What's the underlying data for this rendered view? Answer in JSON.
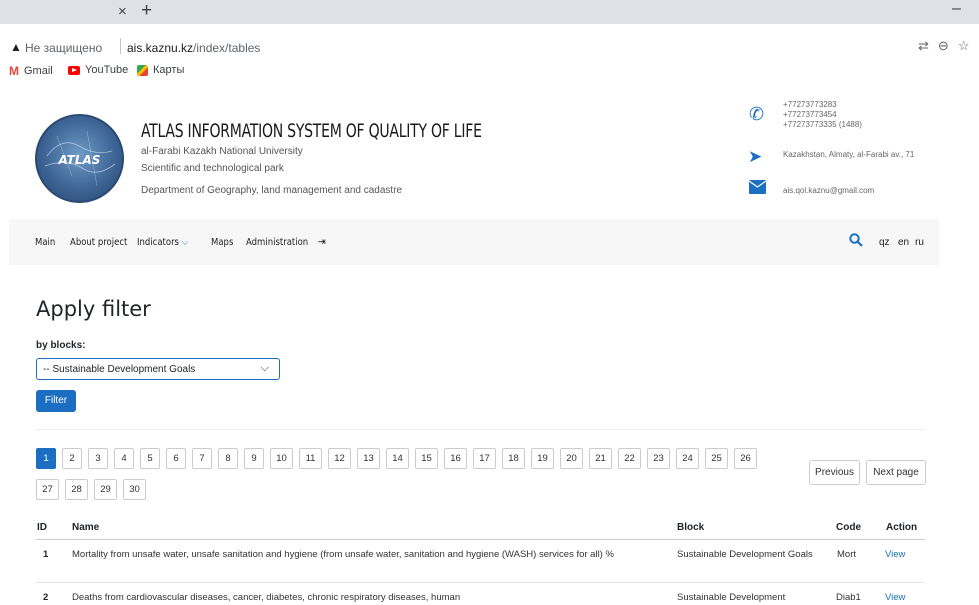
{
  "browser": {
    "tab_close": "×",
    "tab_new": "+",
    "window_minimize": "–",
    "security_text": "Не защищено",
    "url_domain": "ais.kaznu.kz",
    "url_path": "/index/tables",
    "icons": [
      "translate-icon",
      "zoom-icon",
      "bookmark-star-icon"
    ]
  },
  "bookmarks": [
    {
      "label": "Gmail",
      "icon": "gmail-icon"
    },
    {
      "label": "YouTube",
      "icon": "youtube-icon"
    },
    {
      "label": "Карты",
      "icon": "maps-icon"
    }
  ],
  "header": {
    "logo_text": "ATLAS",
    "title": "ATLAS INFORMATION SYSTEM OF QUALITY OF LIFE",
    "university": "al-Farabi Kazakh National University",
    "park": "Scientific and technological park",
    "department": "Department of Geography, land management and cadastre",
    "phones": [
      "+77273773283",
      "+77273773454",
      "+77273773335 (1488)"
    ],
    "address": "Kazakhstan, Almaty, al-Farabi av., 71",
    "email": "ais.qol.kaznu@gmail.com"
  },
  "nav": {
    "items": [
      "Main",
      "About project",
      "Indicators",
      "Maps",
      "Administration"
    ],
    "logout_icon": "sign-out-icon",
    "languages": [
      "qz",
      "en",
      "ru"
    ]
  },
  "filter": {
    "heading": "Apply filter",
    "label": "by blocks:",
    "selected": "-- Sustainable Development Goals",
    "button": "Filter"
  },
  "pagination": {
    "pages": [
      "1",
      "2",
      "3",
      "4",
      "5",
      "6",
      "7",
      "8",
      "9",
      "10",
      "11",
      "12",
      "13",
      "14",
      "15",
      "16",
      "17",
      "18",
      "19",
      "20",
      "21",
      "22",
      "23",
      "24",
      "25",
      "26",
      "27",
      "28",
      "29",
      "30"
    ],
    "active": "1",
    "previous": "Previous",
    "next": "Next page"
  },
  "table": {
    "headers": [
      "ID",
      "Name",
      "Block",
      "Code",
      "Action"
    ],
    "rows": [
      {
        "id": "1",
        "name": "Mortality from unsafe water, unsafe sanitation and hygiene (from unsafe water, sanitation and hygiene (WASH) services for all) %",
        "block": "Sustainable Development Goals",
        "code": "Mort",
        "action": "View"
      },
      {
        "id": "2",
        "name": "Deaths from cardiovascular diseases, cancer, diabetes, chronic respiratory diseases, human",
        "block": "Sustainable Development",
        "code": "Diab1",
        "action": "View"
      }
    ]
  }
}
